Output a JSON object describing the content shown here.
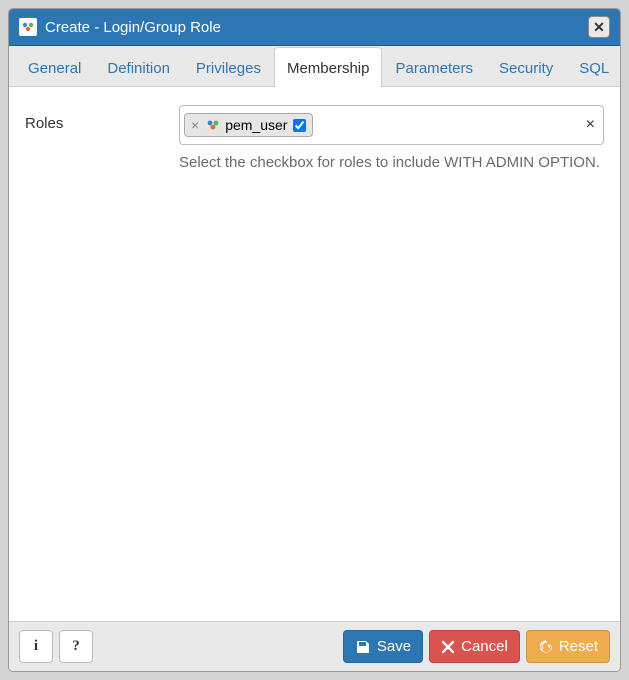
{
  "header": {
    "title": "Create - Login/Group Role",
    "close_symbol": "✕"
  },
  "tabs": [
    {
      "label": "General"
    },
    {
      "label": "Definition"
    },
    {
      "label": "Privileges"
    },
    {
      "label": "Membership",
      "active": true
    },
    {
      "label": "Parameters"
    },
    {
      "label": "Security"
    },
    {
      "label": "SQL"
    }
  ],
  "form": {
    "roles_label": "Roles",
    "chips": [
      {
        "name": "pem_user",
        "checked": true
      }
    ],
    "clear_symbol": "×",
    "help_text": "Select the checkbox for roles to include WITH ADMIN OPTION."
  },
  "footer": {
    "info_label": "i",
    "help_label": "?",
    "save_label": "Save",
    "cancel_label": "Cancel",
    "reset_label": "Reset"
  }
}
